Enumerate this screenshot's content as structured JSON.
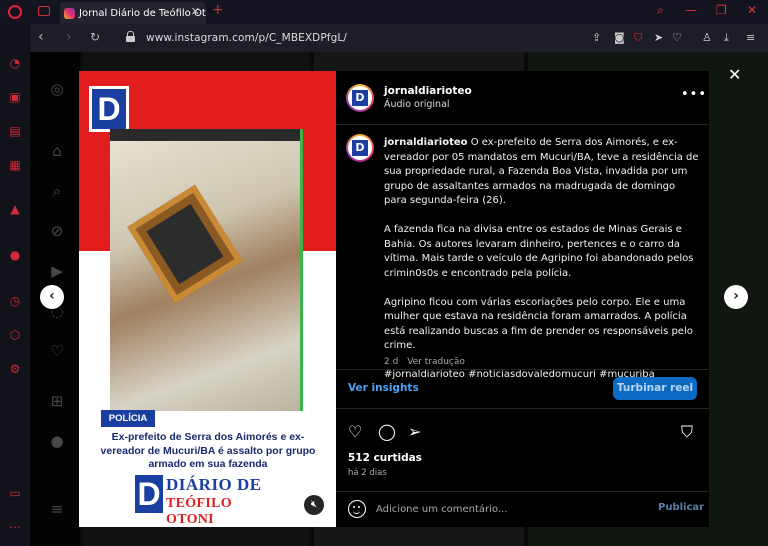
{
  "browser": {
    "tab_title": "Jornal Diário de Teófilo Oto",
    "tab_close": "✕",
    "new_tab": "+",
    "url": "www.instagram.com/p/C_MBEXDPfgL/"
  },
  "media": {
    "badge": "POLÍCIA",
    "headline": "Ex-prefeito de Serra dos Aimorés e ex-vereador de Mucuri/BA é assalto por grupo armado em sua fazenda",
    "brand_letter": "D",
    "brand_line1": "DIÁRIO DE",
    "brand_line2": "TEÓFILO OTONI"
  },
  "post": {
    "username": "jornaldiarioteo",
    "audio": "Áudio original",
    "caption_user": "jornaldiarioteo",
    "caption_p1": "O ex-prefeito de Serra dos Aimorés, e ex-vereador por 05 mandatos em Mucuri/BA, teve a residência de sua propriedade rural, a Fazenda Boa Vista, invadida por um grupo de assaltantes armados na madrugada de domingo para segunda-feira (26).",
    "caption_p2": "A fazenda fica na divisa entre os estados de Minas Gerais e Bahia. Os autores levaram dinheiro, pertences e o carro da vítima. Mais tarde o veículo de Agripino foi abandonado pelos crimin0s0s e encontrado pela polícia.",
    "caption_p3": "Agripino ficou com várias escoriações pelo corpo. Ele e uma mulher que estava na residência foram amarrados. A polícia está realizando buscas a fim de prender os responsáveis pelo crime.",
    "hashtags": "#jornaldiarioteo #noticiasdovaledomucuri #mucuriba",
    "age_short": "2 d",
    "see_translation": "Ver tradução",
    "insights": "Ver insights",
    "boost": "Turbinar reel",
    "likes": "512 curtidas",
    "time_ago": "há 2 dias",
    "comment_placeholder": "Adicione um comentário...",
    "publish": "Publicar"
  }
}
